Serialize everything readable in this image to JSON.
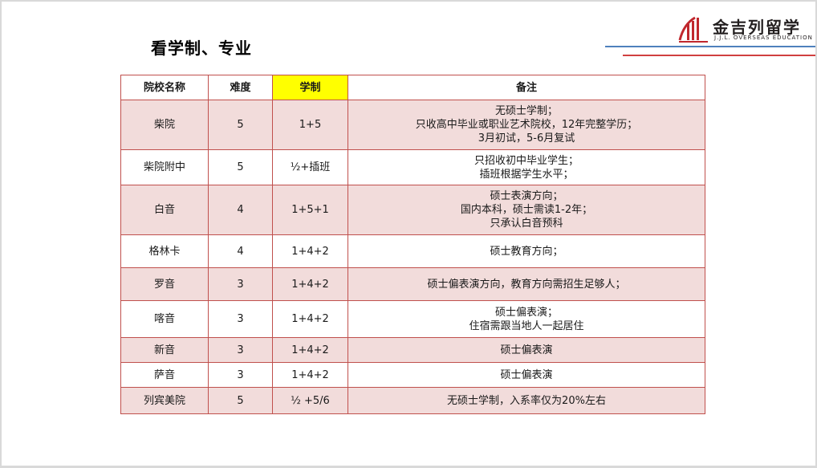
{
  "slide": {
    "title": "看学制、专业",
    "logo": {
      "name": "金吉列留学",
      "sub": "J.J.L. OVERSEAS EDUCATION"
    }
  },
  "table": {
    "headers": [
      "院校名称",
      "难度",
      "学制",
      "备注"
    ],
    "highlight_header_color": "#ffff00",
    "row_fill_color": "#f2dcdb",
    "border_color": "#c0504d",
    "rows": [
      {
        "school": "柴院",
        "difficulty": "5",
        "duration": "1+5",
        "notes": [
          "无硕士学制；",
          "只收高中毕业或职业艺术院校，12年完整学历；",
          "3月初试，5-6月复试"
        ]
      },
      {
        "school": "柴院附中",
        "difficulty": "5",
        "duration": "½+插班",
        "notes": [
          "只招收初中毕业学生；",
          "插班根据学生水平；"
        ]
      },
      {
        "school": "白音",
        "difficulty": "4",
        "duration": "1+5+1",
        "notes": [
          "硕士表演方向；",
          "国内本科，硕士需读1-2年；",
          "只承认白音预科"
        ]
      },
      {
        "school": "格林卡",
        "difficulty": "4",
        "duration": "1+4+2",
        "notes": [
          "硕士教育方向；"
        ]
      },
      {
        "school": "罗音",
        "difficulty": "3",
        "duration": "1+4+2",
        "notes": [
          "硕士偏表演方向，教育方向需招生足够人；"
        ]
      },
      {
        "school": "喀音",
        "difficulty": "3",
        "duration": "1+4+2",
        "notes": [
          "硕士偏表演；",
          "住宿需跟当地人一起居住"
        ]
      },
      {
        "school": "新音",
        "difficulty": "3",
        "duration": "1+4+2",
        "notes": [
          "硕士偏表演"
        ]
      },
      {
        "school": "萨音",
        "difficulty": "3",
        "duration": "1+4+2",
        "notes": [
          "硕士偏表演"
        ]
      },
      {
        "school": "列宾美院",
        "difficulty": "5",
        "duration": "½ +5/6",
        "notes": [
          "无硕士学制，入系率仅为20%左右"
        ]
      }
    ]
  }
}
